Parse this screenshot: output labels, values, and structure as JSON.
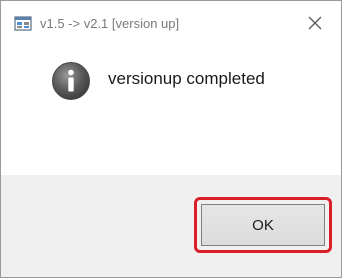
{
  "window": {
    "title": "v1.5 -> v2.1 [version up]",
    "title_icon": "app-window-icon",
    "close_icon": "close-icon"
  },
  "dialog": {
    "icon": "info-icon",
    "message": "versionup completed",
    "ok_label": "OK"
  },
  "colors": {
    "highlight": "#d9202a",
    "footer_bg": "#f0f0f0"
  }
}
